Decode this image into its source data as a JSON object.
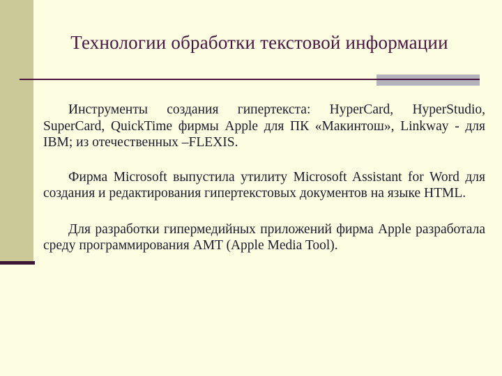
{
  "slide": {
    "title": "Технологии обработки текстовой информации",
    "paragraphs": [
      "Инструменты создания гипертекста: HyperCard, HyperStudio, SuperCard, QuickTime фирмы Apple для ПК «Макинтош», Linkway - для IBM; из отечественных –FLEXIS.",
      "Фирма Microsoft выпустила утилиту Microsoft Assistant for Word для создания и редактирования гипертекстовых документов на языке HTML.",
      "Для разработки гипермедийных приложений фирма Apple разработала среду программирования AMT (Apple Media Tool)."
    ]
  },
  "theme": {
    "background_color": "#fdfde1",
    "sidebar_color": "#ccc999",
    "title_color": "#4a1441",
    "body_text_color": "#1b1b2e",
    "divider_line_color": "#4a1441",
    "divider_block_color": "#b3b2bd"
  }
}
